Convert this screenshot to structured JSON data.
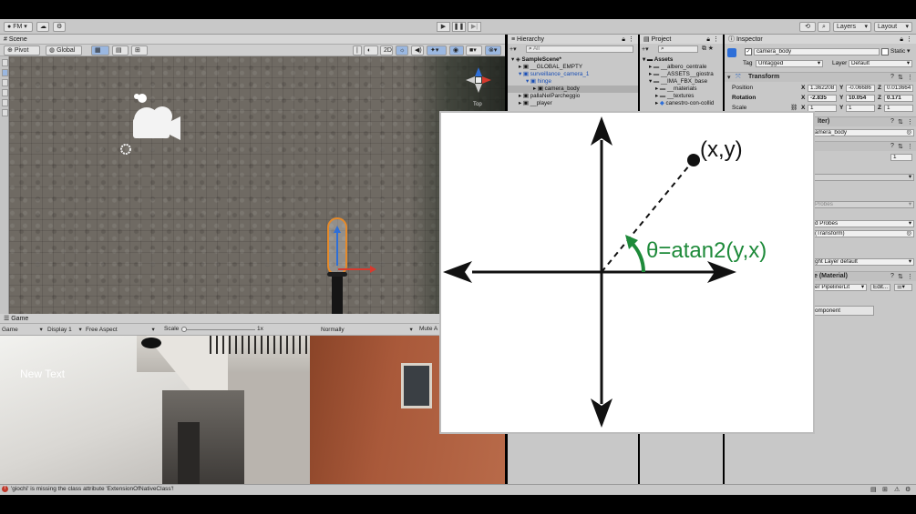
{
  "toolbar": {
    "account": "FM",
    "layers": "Layers",
    "layout": "Layout"
  },
  "scene": {
    "tab": "Scene",
    "pivot": "Pivot",
    "global": "Global",
    "mode_2d": "2D",
    "gizmo_label": "Top"
  },
  "game": {
    "tab": "Game",
    "display_dropdown": "Game",
    "display": "Display 1",
    "aspect": "Free Aspect",
    "scale_label": "Scale",
    "scale_value": "1x",
    "render_mode": "Normally",
    "mute": "Mute A",
    "overlay_text": "New Text"
  },
  "hierarchy": {
    "tab": "Hierarchy",
    "search_placeholder": "All",
    "items": [
      {
        "label": "SampleScene*",
        "indent": 0,
        "type": "scene"
      },
      {
        "label": "__GLOBAL_EMPTY",
        "indent": 1,
        "type": "object"
      },
      {
        "label": "surveillance_camera_1",
        "indent": 1,
        "type": "prefab"
      },
      {
        "label": "hinge",
        "indent": 2,
        "type": "prefab"
      },
      {
        "label": "camera_body",
        "indent": 3,
        "type": "selected"
      },
      {
        "label": "pallaNelParcheggio",
        "indent": 1,
        "type": "object"
      },
      {
        "label": "__player",
        "indent": 1,
        "type": "object"
      }
    ]
  },
  "project": {
    "tab": "Project",
    "assets_root": "Assets",
    "items": [
      {
        "label": "__albero_centrale",
        "indent": 1
      },
      {
        "label": "__ASSETS__giostra",
        "indent": 1
      },
      {
        "label": "__IMA_FBX_base",
        "indent": 1
      },
      {
        "label": "__materials",
        "indent": 2
      },
      {
        "label": "__textures",
        "indent": 2
      },
      {
        "label": "canestro-con-collid",
        "indent": 2
      }
    ]
  },
  "inspector": {
    "tab": "Inspector",
    "object_name": "camera_body",
    "static_label": "Static",
    "tag_label": "Tag",
    "tag_value": "Untagged",
    "layer_label": "Layer",
    "layer_value": "Default",
    "transform_title": "Transform",
    "position_label": "Position",
    "position": {
      "x": "1.362208",
      "y": "-0.06686",
      "z": "0.013664"
    },
    "rotation_label": "Rotation",
    "rotation": {
      "x": "-2.835",
      "y": "10.054",
      "z": "0.171"
    },
    "scale_label": "Scale",
    "scale": {
      "x": "1",
      "y": "1",
      "z": "1"
    },
    "filter_partial": "lter)",
    "mesh_partial": "amera_body",
    "value_one": "1",
    "probes_partial": "Probes",
    "d_probes_partial": "d Probes",
    "transform_ref_partial": "(Transform)",
    "light_layer_partial": "ght Layer default",
    "material_partial": "e (Material)",
    "pipeline_partial": "er Pipeline/Lit",
    "edit_button": "Edit...",
    "component_partial": "omponent"
  },
  "status": {
    "message": "'giochi' is missing the class attribute 'ExtensionOfNativeClass'!"
  },
  "diagram": {
    "point_label": "(x,y)",
    "angle_label": "θ=atan2(y,x)"
  },
  "colors": {
    "angle_green": "#1e8a3a",
    "unity_panel": "#c8c8c8",
    "prefab_blue": "#1a4fb5",
    "error_red": "#c0392b"
  }
}
